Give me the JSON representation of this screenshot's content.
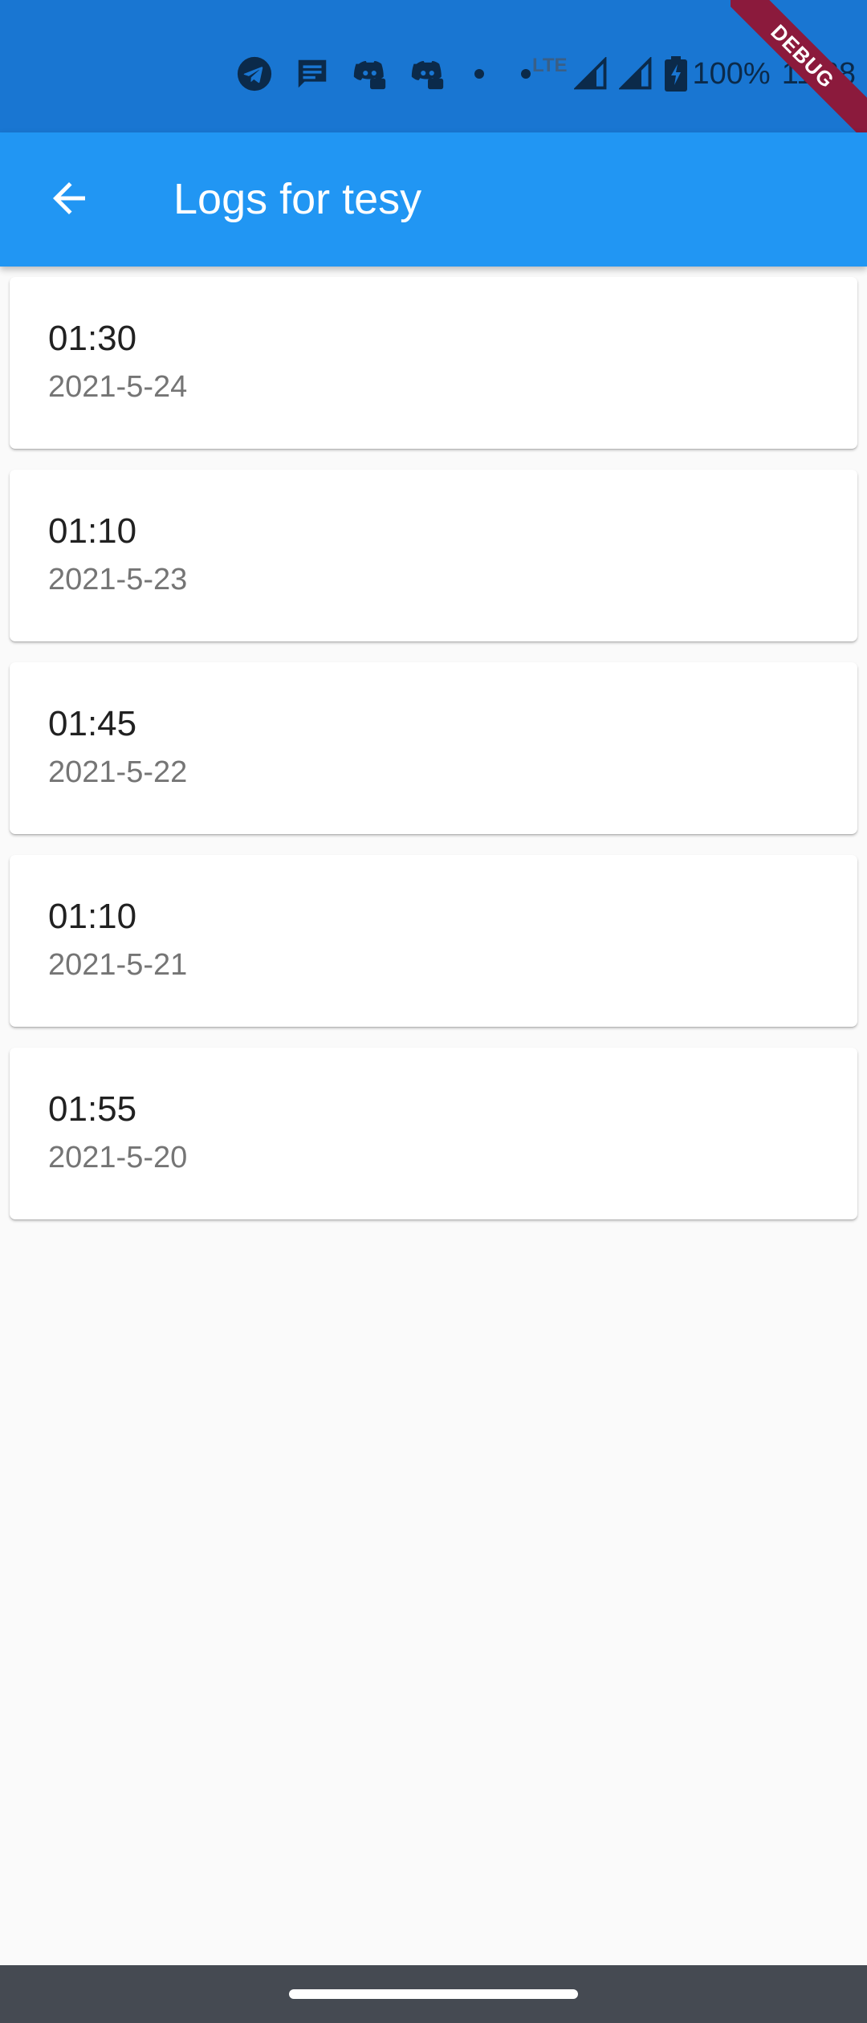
{
  "status_bar": {
    "network_label": "LTE",
    "battery_level": "100%",
    "time": "11:28",
    "icons": [
      "telegram-icon",
      "messages-icon",
      "discord-icon",
      "discord-icon",
      "dot-icon",
      "dot-icon",
      "signal-icon",
      "signal-icon",
      "battery-charging-icon"
    ]
  },
  "debug_banner": "DEBUG",
  "app_bar": {
    "back_icon": "arrow-back-icon",
    "title": "Logs for tesy"
  },
  "logs": [
    {
      "time": "01:30",
      "date": "2021-5-24"
    },
    {
      "time": "01:10",
      "date": "2021-5-23"
    },
    {
      "time": "01:45",
      "date": "2021-5-22"
    },
    {
      "time": "01:10",
      "date": "2021-5-21"
    },
    {
      "time": "01:55",
      "date": "2021-5-20"
    }
  ],
  "colors": {
    "status_bar": "#1976d2",
    "app_bar": "#2196f3",
    "background": "#fafafa",
    "card": "#ffffff",
    "debug_ribbon": "#8b1a3c",
    "nav_bar": "#454a52"
  }
}
